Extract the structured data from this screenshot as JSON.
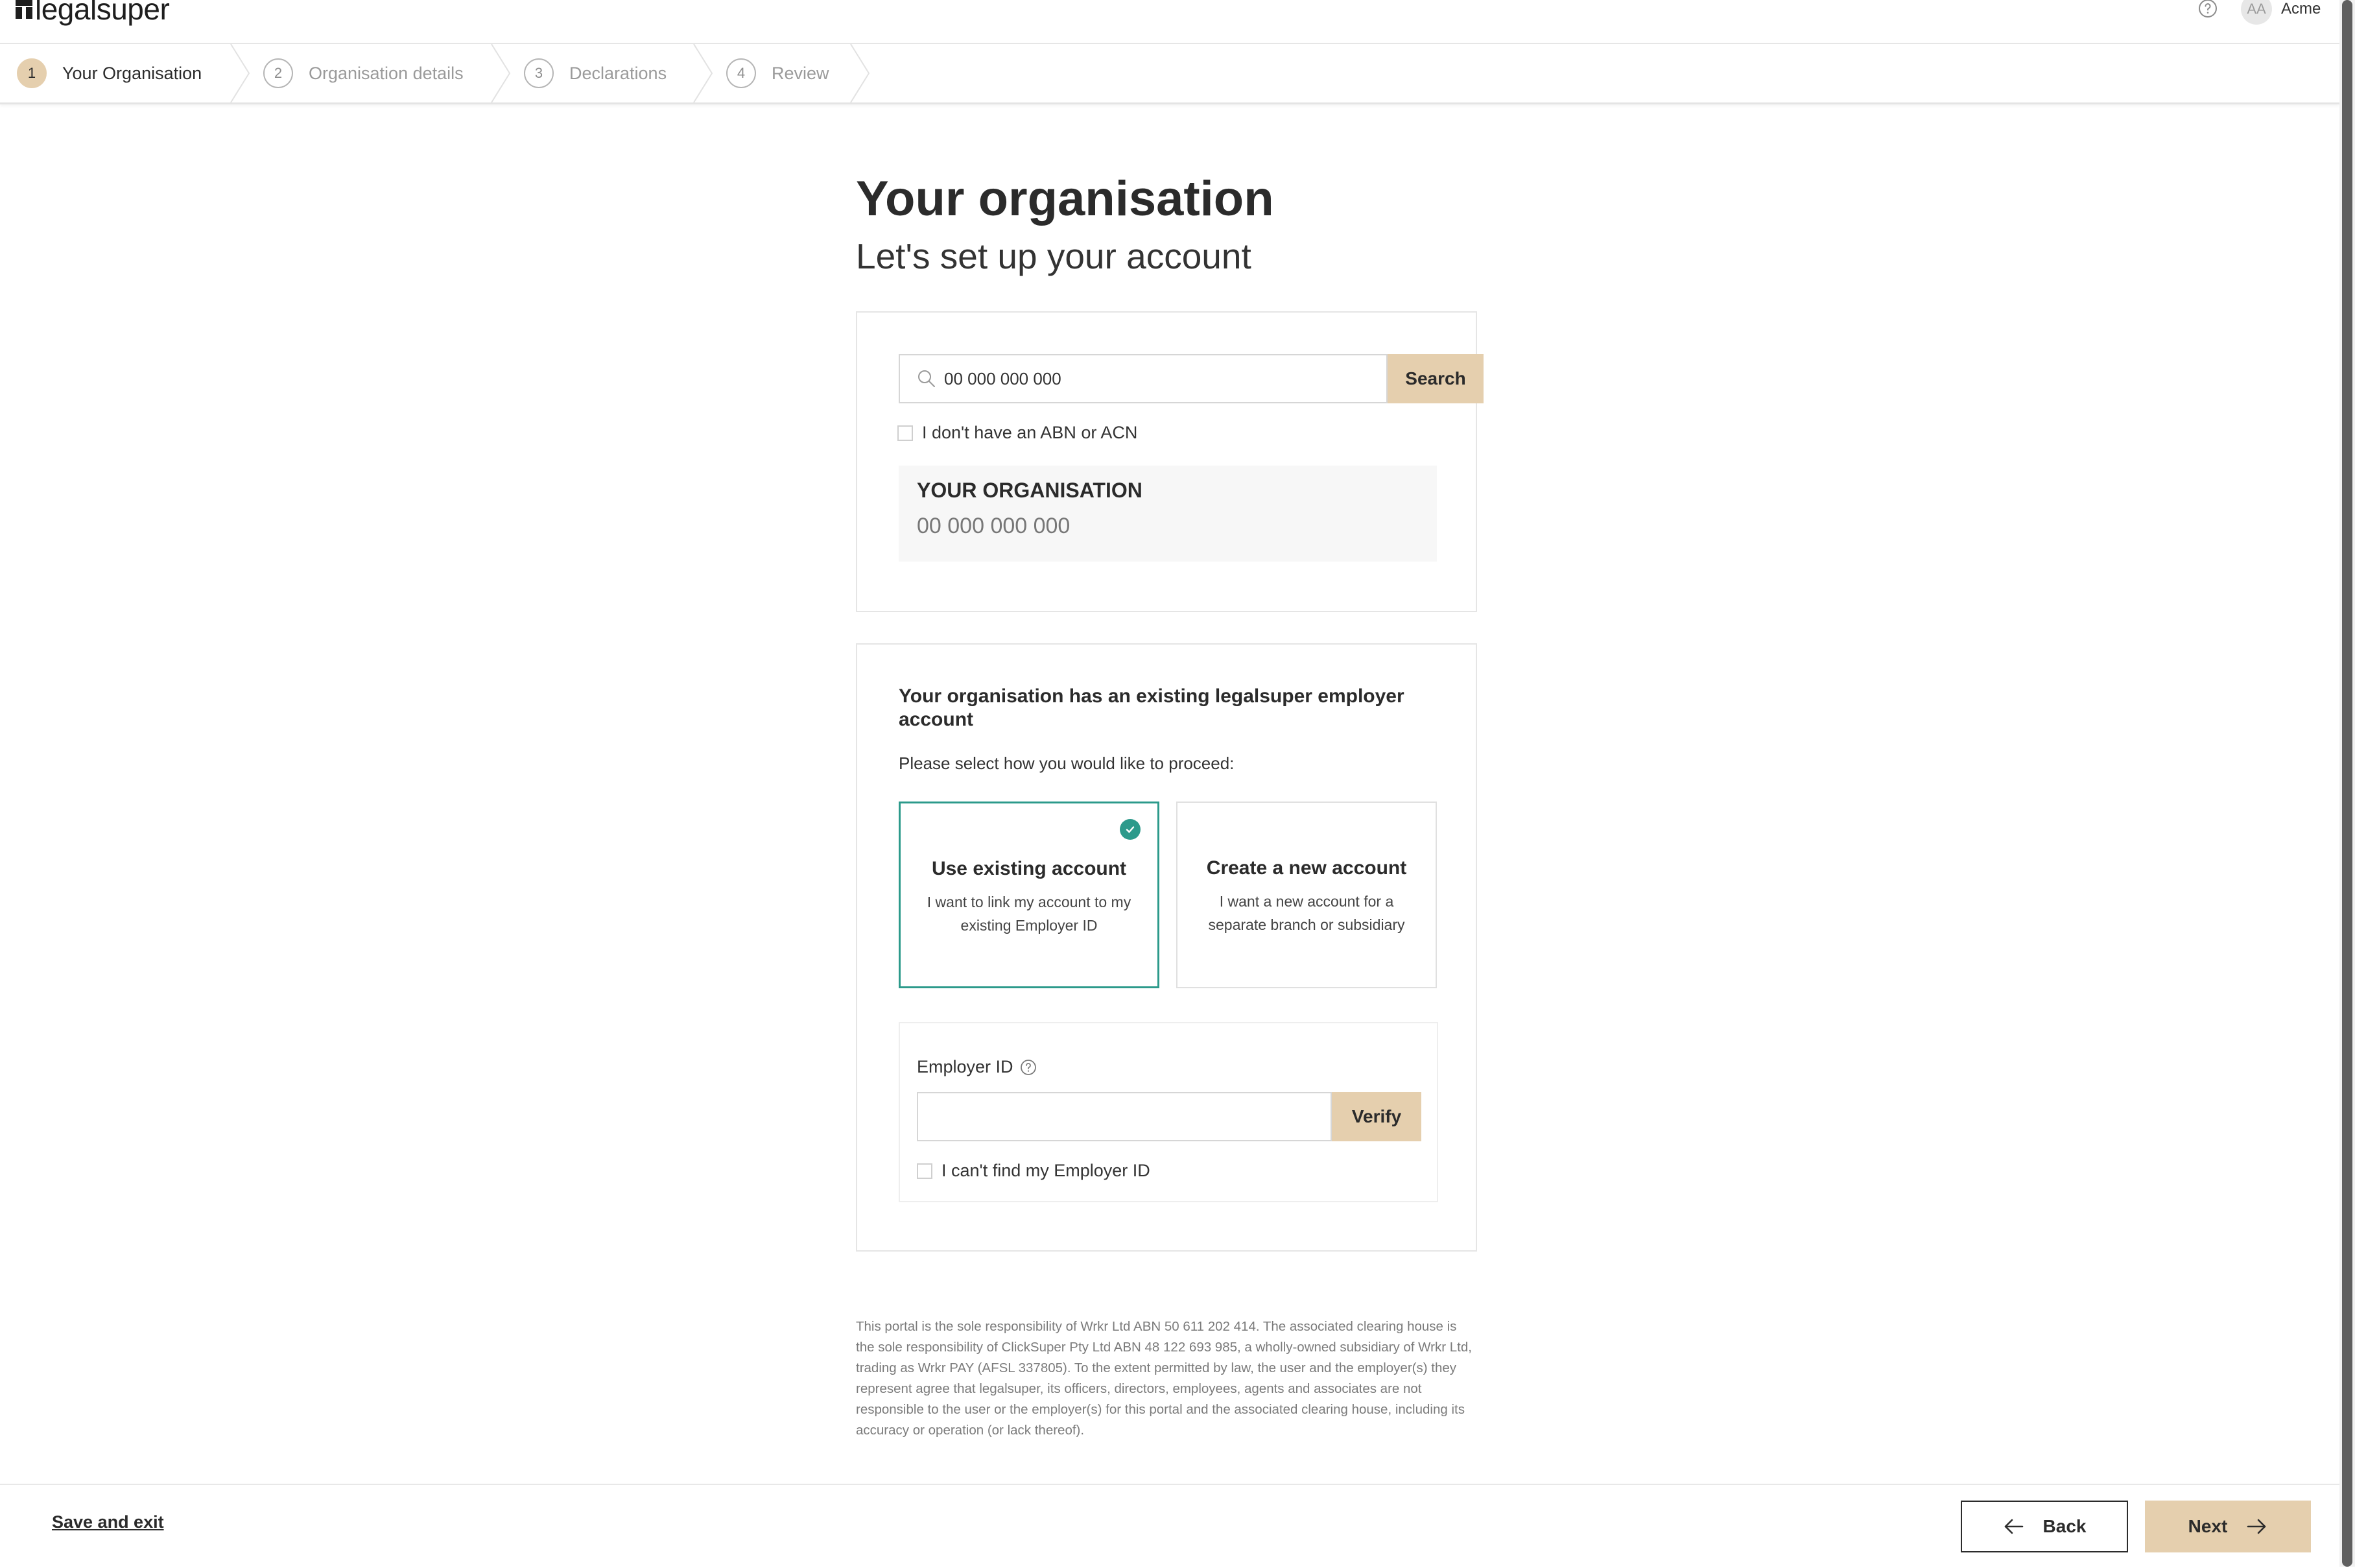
{
  "header": {
    "logo_text": "legalsuper",
    "avatar_initials": "AA",
    "user_name": "Acme",
    "icons": [
      "help-icon"
    ]
  },
  "stepper": {
    "steps": [
      {
        "number": "1",
        "label": "Your Organisation",
        "state": "active"
      },
      {
        "number": "2",
        "label": "Organisation details",
        "state": "pending"
      },
      {
        "number": "3",
        "label": "Declarations",
        "state": "pending"
      },
      {
        "number": "4",
        "label": "Review",
        "state": "pending"
      }
    ]
  },
  "page": {
    "title": "Your organisation",
    "subtitle": "Let's set up your account"
  },
  "search": {
    "value": "00 000 000 000",
    "button_label": "Search",
    "no_abn_label": "I don't have an ABN or ACN",
    "result": {
      "name": "YOUR ORGANISATION",
      "abn": "00 000 000 000"
    }
  },
  "existing": {
    "title": "Your organisation has an existing legalsuper employer account",
    "prompt": "Please select how you would like to proceed:",
    "options": [
      {
        "title": "Use existing account",
        "description": "I want to link my account to my existing Employer ID",
        "selected": true
      },
      {
        "title": "Create a new account",
        "description": "I want a new account for a separate branch or subsidiary",
        "selected": false
      }
    ],
    "employer_id": {
      "label": "Employer ID",
      "value": "",
      "verify_label": "Verify",
      "cant_find_label": "I can't find my Employer ID"
    }
  },
  "disclaimer": "This portal is the sole responsibility of Wrkr Ltd ABN 50 611 202 414. The associated clearing house is the sole responsibility of ClickSuper Pty Ltd ABN 48 122 693 985, a wholly-owned subsidiary of Wrkr Ltd, trading as Wrkr PAY (AFSL 337805). To the extent permitted by law, the user and the employer(s) they represent agree that legalsuper, its officers, directors, employees, agents and associates are not responsible to the user or the employer(s) for this portal and the associated clearing house, including its accuracy or operation (or lack thereof).",
  "footer": {
    "save_exit_label": "Save and exit",
    "back_label": "Back",
    "next_label": "Next"
  },
  "colors": {
    "accent": "#e5cfae",
    "selected_border": "#2c9a8b",
    "text": "#2b2b2b",
    "muted": "#9a9a9a"
  }
}
